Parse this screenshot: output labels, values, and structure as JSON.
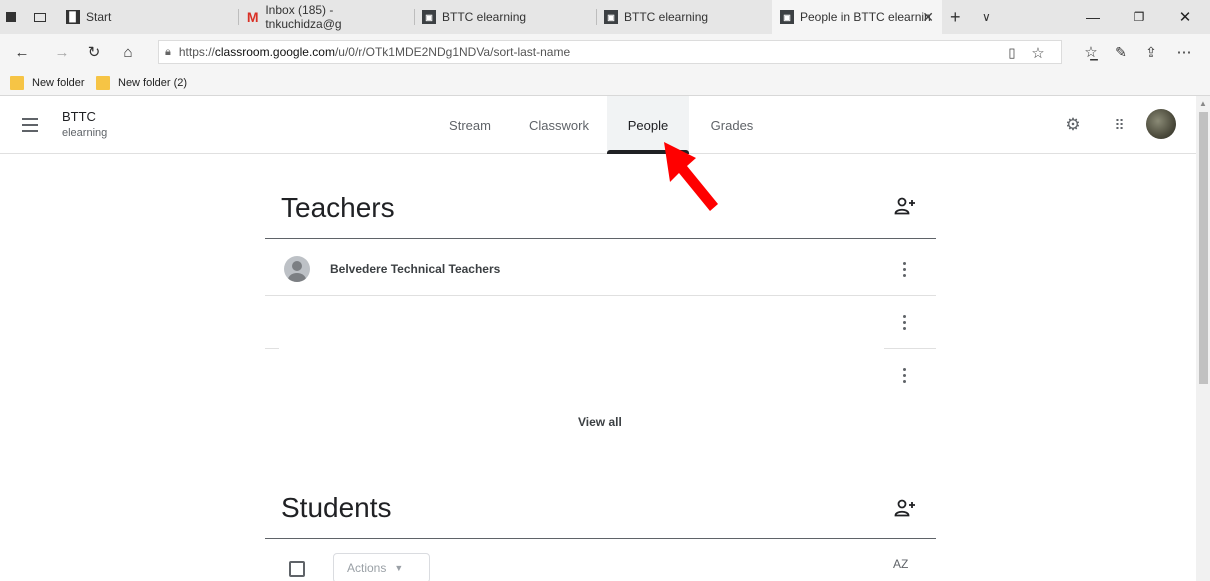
{
  "browser": {
    "tabs": [
      {
        "label": "Start",
        "icon": "start-icon"
      },
      {
        "label": "Inbox (185) - tnkuchidza@g",
        "icon": "gmail-icon"
      },
      {
        "label": "BTTC elearning",
        "icon": "classroom-icon"
      },
      {
        "label": "BTTC elearning",
        "icon": "classroom-icon"
      },
      {
        "label": "People in BTTC elearnin",
        "icon": "classroom-icon",
        "active": true
      }
    ],
    "address": {
      "prefix": "https://",
      "host": "classroom.google.com",
      "path": "/u/0/r/OTk1MDE2NDg1NDVa/sort-last-name"
    },
    "favorites": [
      "New folder",
      "New folder (2)"
    ]
  },
  "classroom": {
    "class_name": "BTTC",
    "class_section": "elearning",
    "tabs": [
      "Stream",
      "Classwork",
      "People",
      "Grades"
    ],
    "active_tab": "People"
  },
  "people": {
    "teachers_title": "Teachers",
    "teachers": [
      "Belvedere Technical Teachers"
    ],
    "view_all": "View all",
    "students_title": "Students",
    "actions_label": "Actions",
    "sort_label": "AZ"
  },
  "colors": {
    "annotation_arrow": "#ff0000",
    "folder": "#f6c445",
    "gmail": "#d93025"
  }
}
